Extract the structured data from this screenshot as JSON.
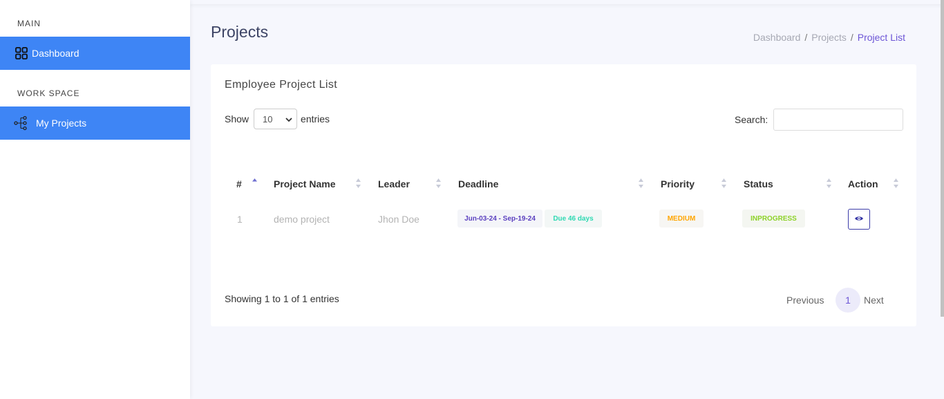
{
  "sidebar": {
    "section_main": "MAIN",
    "dashboard_label": "Dashboard",
    "section_workspace": "WORK SPACE",
    "my_projects_label": "My Projects",
    "active_color": "#3e85f5"
  },
  "header": {
    "title": "Projects",
    "breadcrumb": [
      "Dashboard",
      "Projects",
      "Project List"
    ],
    "breadcrumb_sep": "/"
  },
  "card": {
    "title": "Employee Project List",
    "show_label": "Show",
    "entries_label": "entries",
    "page_length": "10",
    "search_label": "Search:",
    "search_value": ""
  },
  "table": {
    "columns": [
      "#",
      "Project Name",
      "Leader",
      "Deadline",
      "Priority",
      "Status",
      "Action"
    ],
    "rows": [
      {
        "num": "1",
        "project_name": "demo project",
        "leader": "Jhon Doe",
        "deadline_range": "Jun-03-24 - Sep-19-24",
        "due": "Due 46 days",
        "priority": "MEDIUM",
        "status": "INPROGRESS",
        "action_icon": "eye-icon"
      }
    ]
  },
  "footer": {
    "info": "Showing 1 to 1 of 1 entries",
    "previous": "Previous",
    "current_page": "1",
    "next": "Next"
  },
  "colors": {
    "accent": "#6c55d6",
    "priority_medium": "#ffa500",
    "status_inprogress": "#8cd227",
    "due": "#2fd9b2"
  }
}
